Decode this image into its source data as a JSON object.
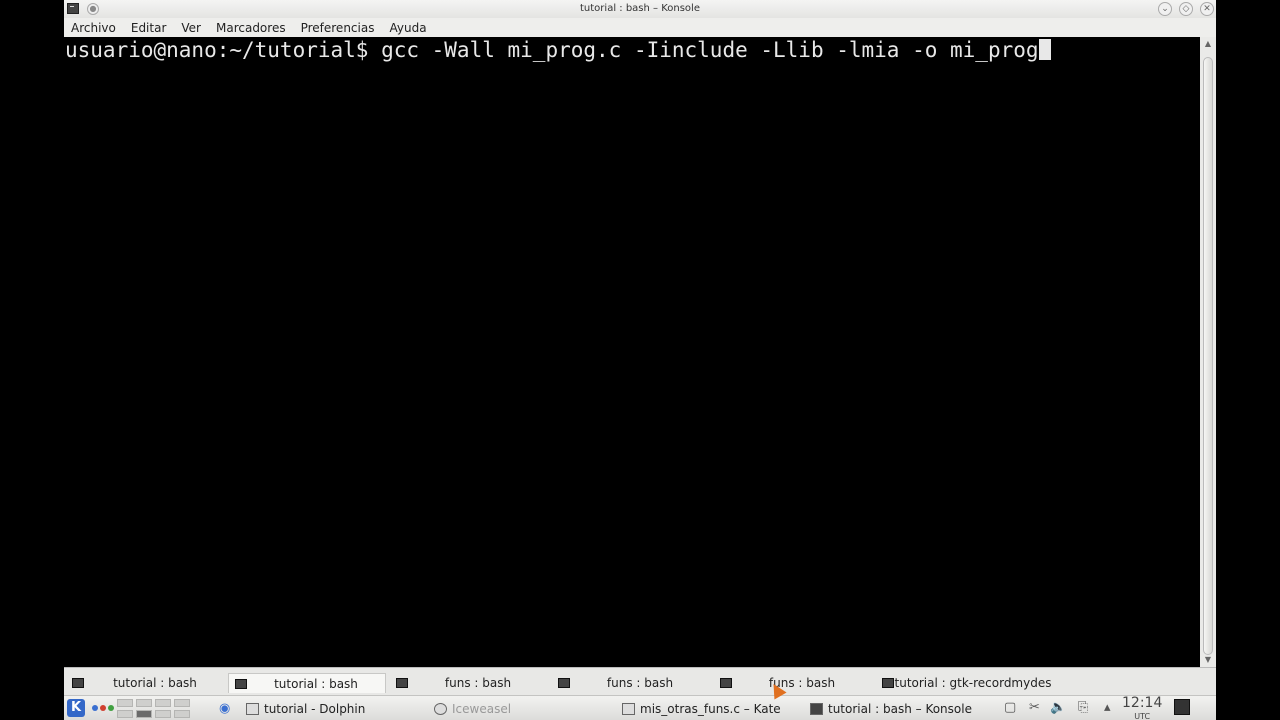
{
  "window": {
    "title": "tutorial : bash – Konsole",
    "menu": [
      "Archivo",
      "Editar",
      "Ver",
      "Marcadores",
      "Preferencias",
      "Ayuda"
    ]
  },
  "terminal": {
    "prompt": "usuario@nano:~/tutorial$ ",
    "command": "gcc -Wall mi_prog.c -Iinclude -Llib -lmia -o mi_prog"
  },
  "tabs": [
    {
      "label": "tutorial : bash"
    },
    {
      "label": "tutorial : bash"
    },
    {
      "label": "funs : bash"
    },
    {
      "label": "funs : bash"
    },
    {
      "label": "funs : bash"
    },
    {
      "label": "tutorial : gtk-recordmydes"
    }
  ],
  "taskbar": {
    "tasks": [
      {
        "label": "tutorial - Dolphin"
      },
      {
        "label": "Iceweasel"
      },
      {
        "label": "mis_otras_funs.c – Kate"
      },
      {
        "label": "tutorial : bash – Konsole"
      }
    ],
    "clock": {
      "time": "12:14",
      "zone": "UTC"
    }
  },
  "icons": [
    "k-menu-icon",
    "terminal-icon",
    "pin-icon",
    "minimize-icon",
    "maximize-icon",
    "close-icon",
    "scissors-icon",
    "volume-icon",
    "network-icon"
  ]
}
